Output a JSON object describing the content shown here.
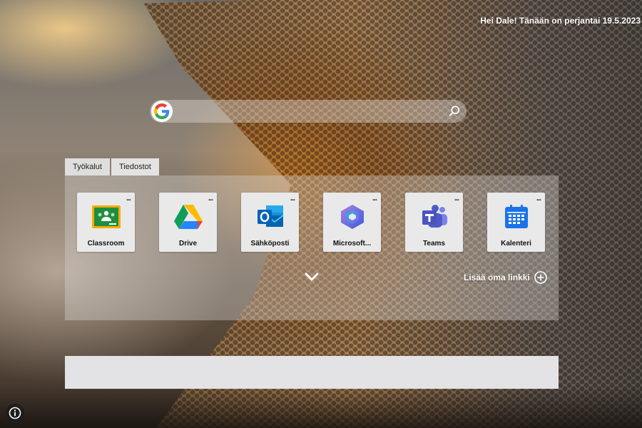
{
  "greeting": "Hei Dale! Tänään on perjantai 19.5.2023",
  "search": {
    "placeholder": "",
    "value": ""
  },
  "tabs": [
    {
      "label": "Työkalut",
      "active": true
    },
    {
      "label": "Tiedostot",
      "active": false
    }
  ],
  "tiles": [
    {
      "label": "Classroom",
      "menu": "...",
      "icon": "google-classroom-icon"
    },
    {
      "label": "Drive",
      "menu": "...",
      "icon": "google-drive-icon"
    },
    {
      "label": "Sähköposti",
      "menu": "...",
      "icon": "outlook-icon"
    },
    {
      "label": "Microsoft...",
      "menu": "...",
      "icon": "microsoft-365-icon"
    },
    {
      "label": "Teams",
      "menu": "...",
      "icon": "teams-icon"
    },
    {
      "label": "Kalenteri",
      "menu": "...",
      "icon": "calendar-icon"
    }
  ],
  "add_link": {
    "label": "Lisää oma linkki"
  },
  "colors": {
    "panel": "#d7d4d2",
    "tile": "#e9e9ea",
    "bottom_box": "#e3e3e5",
    "text_light": "#ffffff"
  }
}
